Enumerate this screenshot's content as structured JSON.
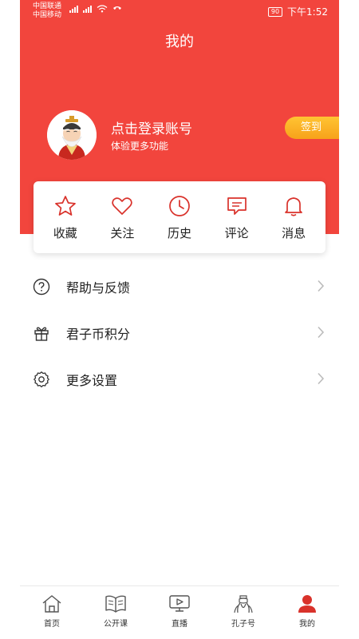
{
  "status_bar": {
    "carrier_1": "中国联通",
    "carrier_2": "中国移动",
    "battery": "90",
    "time": "下午1:52"
  },
  "header": {
    "title": "我的",
    "login_text": "点击登录账号",
    "login_sub": "体验更多功能",
    "signin_label": "签到"
  },
  "quick_actions": [
    {
      "label": "收藏",
      "icon": "star-icon"
    },
    {
      "label": "关注",
      "icon": "heart-icon"
    },
    {
      "label": "历史",
      "icon": "clock-icon"
    },
    {
      "label": "评论",
      "icon": "comment-icon"
    },
    {
      "label": "消息",
      "icon": "bell-icon"
    }
  ],
  "menu": [
    {
      "label": "帮助与反馈",
      "icon": "help-icon"
    },
    {
      "label": "君子币积分",
      "icon": "gift-icon"
    },
    {
      "label": "更多设置",
      "icon": "gear-icon"
    }
  ],
  "bottom_nav": [
    {
      "label": "首页",
      "icon": "home-icon"
    },
    {
      "label": "公开课",
      "icon": "book-icon"
    },
    {
      "label": "直播",
      "icon": "live-icon"
    },
    {
      "label": "孔子号",
      "icon": "confucius-icon"
    },
    {
      "label": "我的",
      "icon": "person-icon",
      "active": true
    }
  ],
  "colors": {
    "brand_red": "#f2453d",
    "signin_orange": "#f7a21a",
    "icon_red": "#d9322b"
  }
}
